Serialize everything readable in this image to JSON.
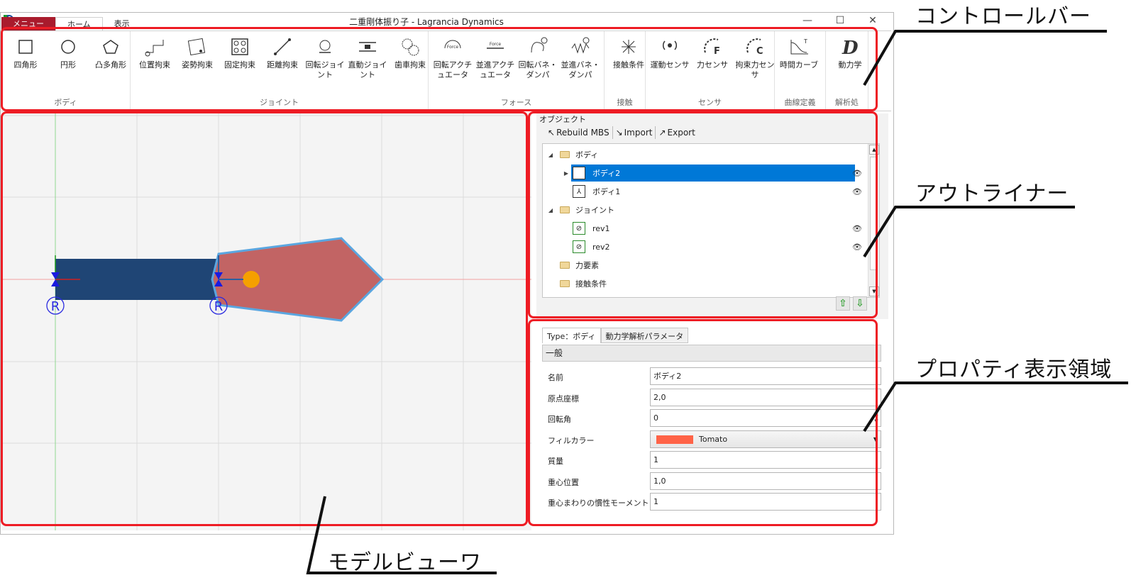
{
  "window": {
    "title": "二重剛体振り子 - Lagrancia Dynamics",
    "quick_access": [
      "↶",
      "↷",
      "▾"
    ],
    "controls": [
      "—",
      "☐",
      "✕"
    ]
  },
  "ribbon": {
    "tabs": [
      {
        "label": "メニュー"
      },
      {
        "label": "ホーム"
      },
      {
        "label": "表示"
      }
    ],
    "groups": [
      {
        "label": "ボディ",
        "items": [
          {
            "label": "四角形",
            "icon": "square-icon"
          },
          {
            "label": "円形",
            "icon": "circle-icon"
          },
          {
            "label": "凸多角形",
            "icon": "polygon-icon"
          }
        ]
      },
      {
        "label": "ジョイント",
        "items": [
          {
            "label": "位置拘束",
            "icon": "position-constraint-icon"
          },
          {
            "label": "姿勢拘束",
            "icon": "orientation-constraint-icon"
          },
          {
            "label": "固定拘束",
            "icon": "fixed-constraint-icon"
          },
          {
            "label": "距離拘束",
            "icon": "distance-constraint-icon"
          },
          {
            "label": "回転ジョイント",
            "icon": "revolute-joint-icon"
          },
          {
            "label": "直動ジョイント",
            "icon": "prismatic-joint-icon"
          },
          {
            "label": "歯車拘束",
            "icon": "gear-constraint-icon"
          }
        ]
      },
      {
        "label": "フォース",
        "items": [
          {
            "label": "回転アクチュエータ",
            "icon": "rotary-actuator-icon"
          },
          {
            "label": "並進アクチュエータ",
            "icon": "linear-actuator-icon"
          },
          {
            "label": "回転バネ・ダンパ",
            "icon": "rotary-spring-icon"
          },
          {
            "label": "並進バネ・ダンパ",
            "icon": "linear-spring-icon"
          }
        ]
      },
      {
        "label": "接触",
        "items": [
          {
            "label": "接触条件",
            "icon": "contact-icon"
          }
        ]
      },
      {
        "label": "センサ",
        "items": [
          {
            "label": "運動センサ",
            "icon": "motion-sensor-icon"
          },
          {
            "label": "力センサ",
            "icon": "force-sensor-icon"
          },
          {
            "label": "拘束力センサ",
            "icon": "constraint-force-sensor-icon"
          }
        ]
      },
      {
        "label": "曲線定義",
        "items": [
          {
            "label": "時間カーブ",
            "icon": "time-curve-icon"
          }
        ]
      },
      {
        "label": "解析処",
        "items": [
          {
            "label": "動力学",
            "icon": "dynamics-icon"
          }
        ]
      }
    ]
  },
  "outliner": {
    "title": "オブジェクト",
    "toolbar": [
      {
        "label": "Rebuild MBS",
        "icon": "rebuild-icon"
      },
      {
        "label": "Import",
        "icon": "import-icon"
      },
      {
        "label": "Export",
        "icon": "export-icon"
      }
    ],
    "tree": [
      {
        "label": "ボディ",
        "type": "folder",
        "level": 0,
        "expanded": true
      },
      {
        "label": "ボディ2",
        "type": "body",
        "level": 1,
        "selected": true,
        "eye": true
      },
      {
        "label": "ボディ1",
        "type": "body",
        "level": 1,
        "eye": true
      },
      {
        "label": "ジョイント",
        "type": "folder",
        "level": 0,
        "expanded": true
      },
      {
        "label": "rev1",
        "type": "joint",
        "level": 1,
        "eye": true
      },
      {
        "label": "rev2",
        "type": "joint",
        "level": 1,
        "eye": true
      },
      {
        "label": "力要素",
        "type": "folder",
        "level": 0
      },
      {
        "label": "接触条件",
        "type": "folder",
        "level": 0
      }
    ],
    "up_label": "⇧",
    "down_label": "⇩"
  },
  "properties": {
    "tabs": [
      {
        "label": "Type：ボディ"
      },
      {
        "label": "動力学解析パラメータ"
      }
    ],
    "section": "一般",
    "rows": [
      {
        "label": "名前",
        "value": "ボディ2"
      },
      {
        "label": "原点座標",
        "value": "2,0"
      },
      {
        "label": "回転角",
        "value": "0"
      },
      {
        "label": "フィルカラー",
        "value": "Tomato"
      },
      {
        "label": "質量",
        "value": "1"
      },
      {
        "label": "重心位置",
        "value": "1,0"
      },
      {
        "label": "重心まわりの慣性モーメント",
        "value": "1"
      }
    ]
  },
  "viewer": {
    "joint_marker": "R"
  },
  "callouts": {
    "controlbar": "コントロールバー",
    "outliner": "アウトライナー",
    "properties": "プロパティ表示領域",
    "viewer": "モデルビューワ"
  },
  "colors": {
    "accent": "#a91b2d",
    "selection": "#0078d7",
    "callout_box": "#ee1c24",
    "body1": "#1f4575",
    "body2": "#c26464",
    "fill_color": "#ff6347"
  }
}
